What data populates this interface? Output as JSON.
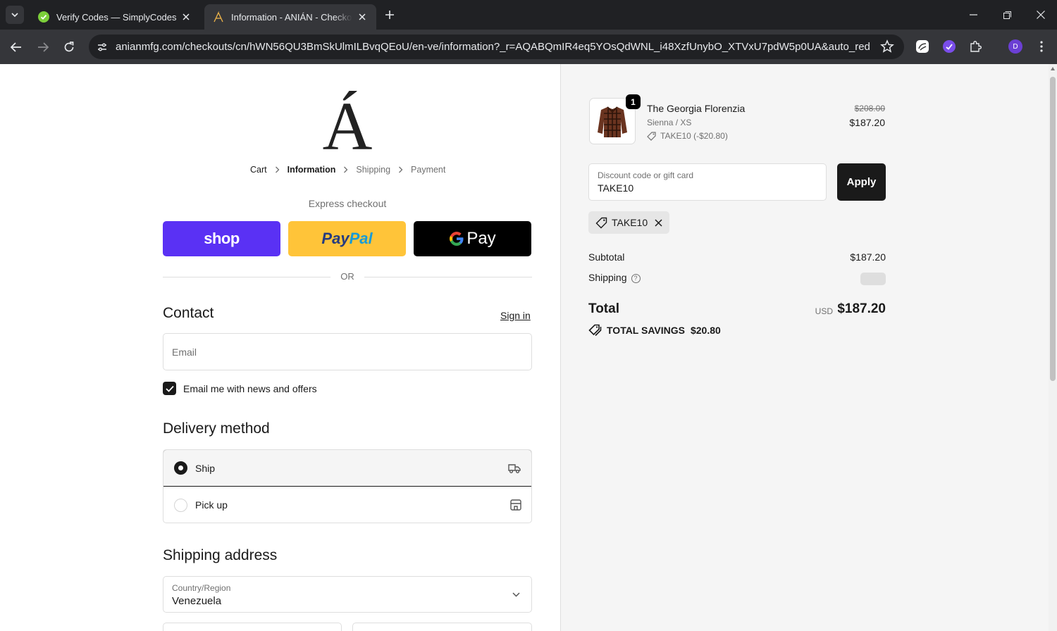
{
  "browser": {
    "tabs": [
      {
        "title": "Verify Codes — SimplyCodes",
        "active": false
      },
      {
        "title": "Information - ANIÁN - Checkout",
        "active": true
      }
    ],
    "url": "anianmfg.com/checkouts/cn/hWN56QU3BmSkUlmILBvqQEoU/en-ve/information?_r=AQABQmIR4eq5YOsQdWNL_i48XzfUnybO_XTVxU7pdW5p0UA&auto_redirect=...",
    "profile_initial": "D"
  },
  "checkout": {
    "logo_letter": "Á",
    "breadcrumb": [
      "Cart",
      "Information",
      "Shipping",
      "Payment"
    ],
    "express_label": "Express checkout",
    "pay_buttons": {
      "shop": "shop",
      "paypal_a": "Pay",
      "paypal_b": "Pal",
      "gpay": "Pay"
    },
    "or_label": "OR",
    "contact": {
      "title": "Contact",
      "signin": "Sign in",
      "email_placeholder": "Email",
      "newsletter_label": "Email me with news and offers",
      "newsletter_checked": true
    },
    "delivery": {
      "title": "Delivery method",
      "options": [
        {
          "label": "Ship",
          "selected": true
        },
        {
          "label": "Pick up",
          "selected": false
        }
      ]
    },
    "shipping_address": {
      "title": "Shipping address",
      "country_label": "Country/Region",
      "country_value": "Venezuela"
    }
  },
  "summary": {
    "item": {
      "quantity": "1",
      "name": "The Georgia Florenzia",
      "variant": "Sienna / XS",
      "discount": "TAKE10 (-$20.80)",
      "price_original": "$208.00",
      "price_final": "$187.20"
    },
    "discount_field": {
      "label": "Discount code or gift card",
      "value": "TAKE10"
    },
    "apply_label": "Apply",
    "applied_code": "TAKE10",
    "subtotal_label": "Subtotal",
    "subtotal_value": "$187.20",
    "shipping_label": "Shipping",
    "total_label": "Total",
    "total_currency": "USD",
    "total_value": "$187.20",
    "savings_label": "TOTAL SAVINGS",
    "savings_value": "$20.80"
  },
  "colors": {
    "shop_pay": "#5a31f4",
    "paypal": "#ffc439",
    "gpay": "#000000",
    "primary": "#1a1a1a",
    "summary_bg": "#f5f5f5"
  },
  "icons": [
    "tab-list-icon",
    "simplycodes-favicon",
    "anian-favicon",
    "close-icon",
    "plus-icon",
    "minimize-icon",
    "restore-icon",
    "back-icon",
    "forward-icon",
    "reload-icon",
    "site-settings-icon",
    "star-icon",
    "extension-icon",
    "puzzle-icon",
    "chevron-right-icon",
    "google-g-icon",
    "checkmark-icon",
    "truck-icon",
    "store-icon",
    "chevron-down-icon",
    "tag-icon",
    "help-icon",
    "savings-tag-icon"
  ]
}
